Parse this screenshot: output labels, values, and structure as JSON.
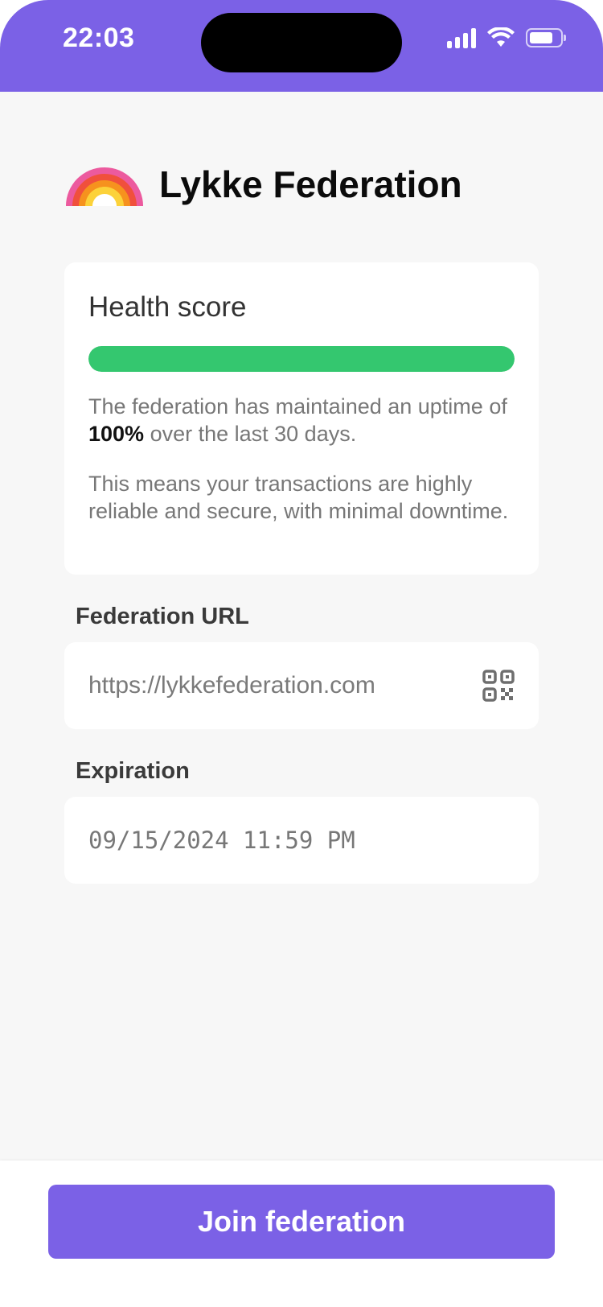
{
  "status_bar": {
    "time": "22:03",
    "background": "#7b61e6",
    "icons": [
      "signal-icon",
      "wifi-icon",
      "battery-icon"
    ]
  },
  "header": {
    "logo": "rainbow-logo",
    "title": "Lykke Federation"
  },
  "health": {
    "title": "Health score",
    "progress_percent": 100,
    "progress_color": "#34c76f",
    "text_before": "The federation has maintained an uptime of ",
    "text_bold": "100%",
    "text_after": " over the last 30 days.",
    "text2": "This means your transactions are highly reliable and secure, with minimal downtime."
  },
  "federation_url": {
    "label": "Federation URL",
    "value": "https://lykkefederation.com",
    "icon": "qr-code-icon"
  },
  "expiration": {
    "label": "Expiration",
    "value": "09/15/2024 11:59 PM"
  },
  "actions": {
    "join_label": "Join federation",
    "accent": "#7b61e6"
  }
}
